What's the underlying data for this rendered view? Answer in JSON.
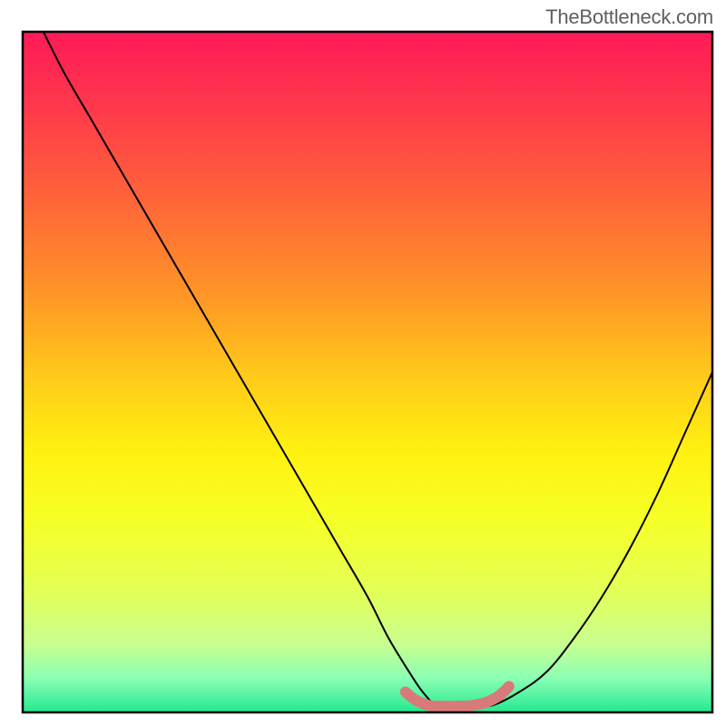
{
  "attribution": "TheBottleneck.com",
  "chart_data": {
    "type": "line",
    "title": "",
    "xlabel": "",
    "ylabel": "",
    "xlim": [
      0,
      100
    ],
    "ylim": [
      0,
      100
    ],
    "grid": false,
    "legend": false,
    "background_gradient": {
      "stops": [
        {
          "offset": 0.0,
          "color": "#ff1a58"
        },
        {
          "offset": 0.12,
          "color": "#ff3b4a"
        },
        {
          "offset": 0.25,
          "color": "#ff6638"
        },
        {
          "offset": 0.38,
          "color": "#ff9328"
        },
        {
          "offset": 0.5,
          "color": "#ffc81b"
        },
        {
          "offset": 0.62,
          "color": "#fff210"
        },
        {
          "offset": 0.72,
          "color": "#f5ff28"
        },
        {
          "offset": 0.82,
          "color": "#e4ff55"
        },
        {
          "offset": 0.9,
          "color": "#c8ff90"
        },
        {
          "offset": 0.95,
          "color": "#8affb4"
        },
        {
          "offset": 1.0,
          "color": "#23e890"
        }
      ]
    },
    "series": [
      {
        "name": "bottleneck-curve",
        "color": "#000000",
        "width": 2,
        "x": [
          3,
          6,
          10,
          14,
          18,
          22,
          26,
          30,
          34,
          38,
          42,
          46,
          50,
          53,
          56,
          58,
          60,
          62,
          65,
          68,
          72,
          76,
          80,
          84,
          88,
          92,
          96,
          100
        ],
        "y": [
          100,
          94,
          87,
          80,
          73,
          66,
          59,
          52,
          45,
          38,
          31,
          24,
          17,
          11,
          6,
          3,
          1,
          1,
          1,
          1,
          3,
          6,
          11,
          17,
          24,
          32,
          41,
          50
        ]
      },
      {
        "name": "optimal-range-highlight",
        "color": "#d97a7a",
        "width": 12,
        "linecap": "round",
        "x": [
          55.5,
          57,
          59,
          61,
          63,
          65,
          67,
          69,
          70.5
        ],
        "y": [
          3.0,
          1.8,
          1.0,
          0.9,
          0.9,
          1.0,
          1.4,
          2.4,
          3.8
        ]
      }
    ],
    "annotations": []
  }
}
